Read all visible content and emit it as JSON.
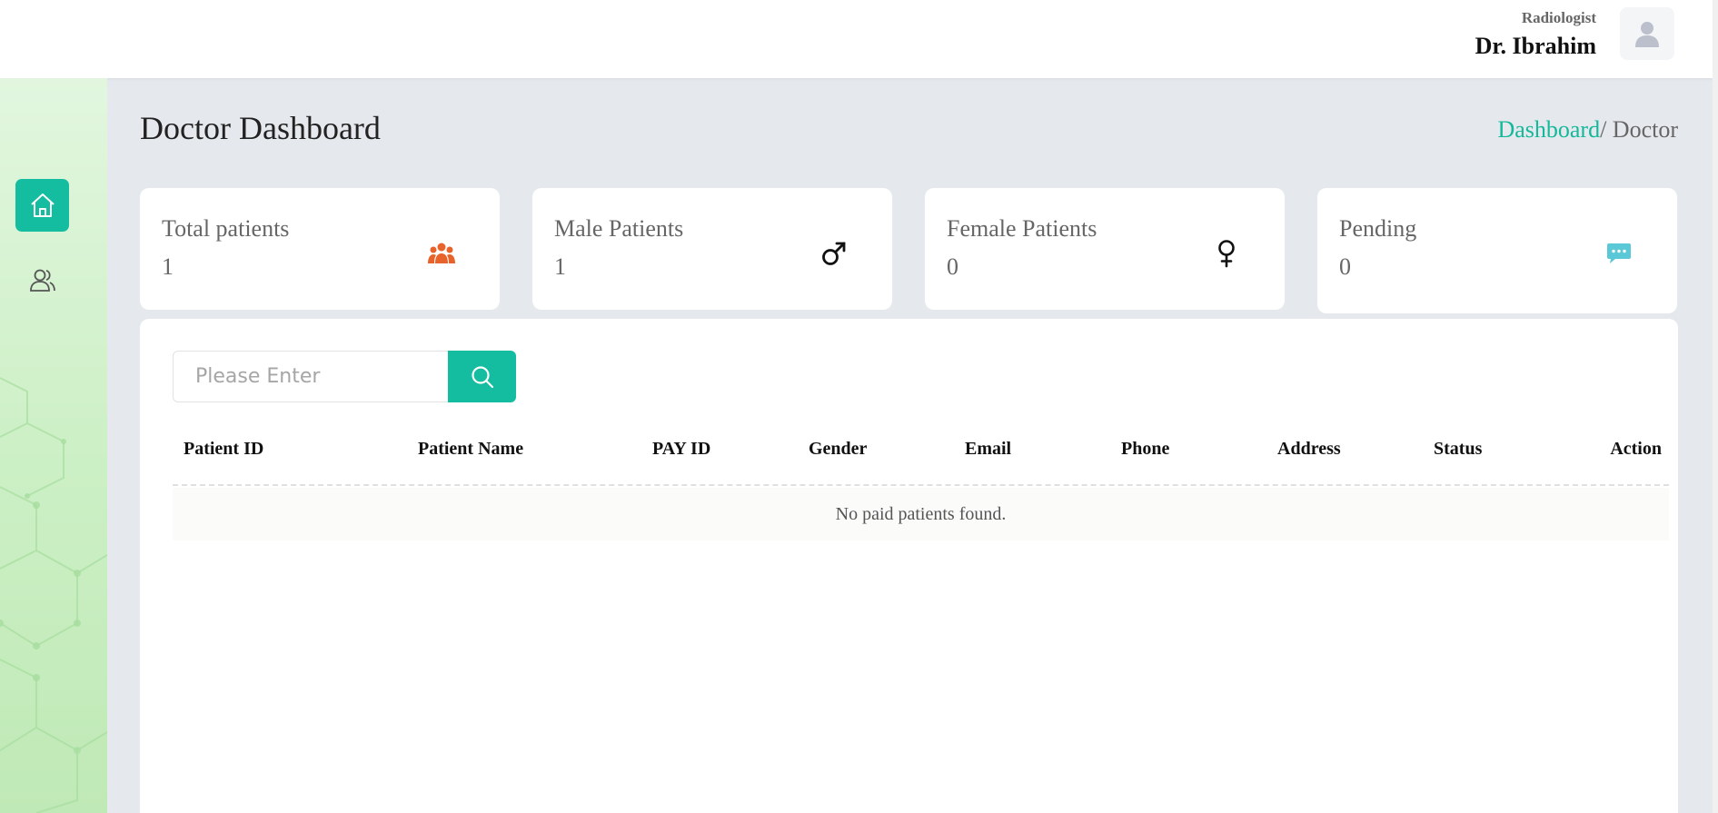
{
  "header": {
    "role": "Radiologist",
    "name": "Dr. Ibrahim",
    "avatar_icon": "user-avatar-icon"
  },
  "sidebar": {
    "items": [
      {
        "icon": "home-icon",
        "active": true
      },
      {
        "icon": "users-icon",
        "active": false
      }
    ],
    "accent": "#14bd9f"
  },
  "page": {
    "title": "Doctor Dashboard",
    "breadcrumb": {
      "home": "Dashboard",
      "current": "/ Doctor"
    }
  },
  "cards": [
    {
      "label": "Total patients",
      "value": "1",
      "icon": "group-icon",
      "icon_color": "#e8622c"
    },
    {
      "label": "Male Patients",
      "value": "1",
      "icon": "male-icon",
      "icon_color": "#111111"
    },
    {
      "label": "Female Patients",
      "value": "0",
      "icon": "female-icon",
      "icon_color": "#111111"
    },
    {
      "label": "Pending",
      "value": "0",
      "icon": "chat-icon",
      "icon_color": "#5bc8d8"
    }
  ],
  "search": {
    "placeholder": "Please Enter",
    "value": ""
  },
  "table": {
    "columns": [
      "Patient ID",
      "Patient Name",
      "PAY ID",
      "Gender",
      "Email",
      "Phone",
      "Address",
      "Status",
      "Action"
    ],
    "empty_message": "No paid patients found."
  }
}
